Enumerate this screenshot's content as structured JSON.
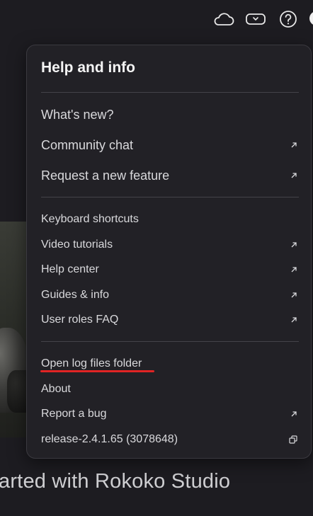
{
  "topbar": {
    "icons": [
      "cloud-icon",
      "headset-icon",
      "help-icon"
    ]
  },
  "menu": {
    "title": "Help and info",
    "section1": [
      {
        "label": "What's new?",
        "external": false
      },
      {
        "label": "Community chat",
        "external": true
      },
      {
        "label": "Request a new feature",
        "external": true
      }
    ],
    "section2": [
      {
        "label": "Keyboard shortcuts",
        "external": false
      },
      {
        "label": "Video tutorials",
        "external": true
      },
      {
        "label": "Help center",
        "external": true
      },
      {
        "label": "Guides & info",
        "external": true
      },
      {
        "label": "User roles FAQ",
        "external": true
      }
    ],
    "section3": [
      {
        "label": "Open log files folder",
        "external": false
      },
      {
        "label": "About",
        "external": false
      },
      {
        "label": "Report a bug",
        "external": true
      },
      {
        "label": "release-2.4.1.65 (3078648)",
        "external": false,
        "copy": true
      }
    ],
    "highlight_color": "#e02424"
  },
  "background": {
    "heading": "arted with Rokoko Studio"
  }
}
